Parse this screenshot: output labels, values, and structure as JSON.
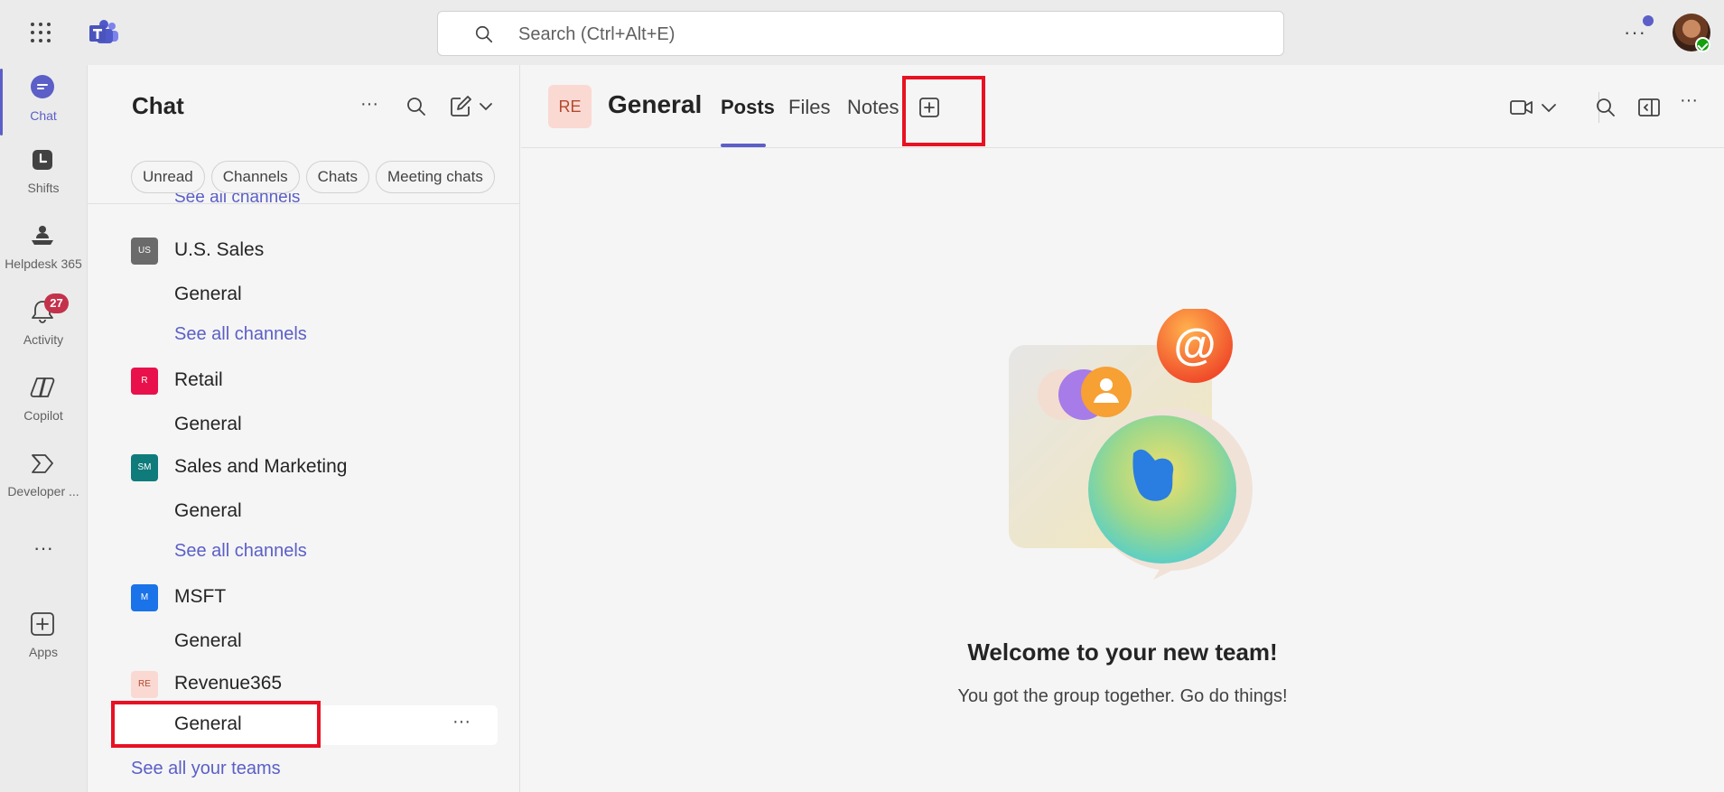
{
  "topbar": {
    "search_placeholder": "Search (Ctrl+Alt+E)",
    "more_label": "···"
  },
  "rail": {
    "items": [
      {
        "label": "Chat",
        "icon": "chat-icon",
        "active": true
      },
      {
        "label": "Shifts",
        "icon": "shifts-icon"
      },
      {
        "label": "Helpdesk 365",
        "icon": "helpdesk-icon"
      },
      {
        "label": "Activity",
        "icon": "bell-icon",
        "badge": "27"
      },
      {
        "label": "Copilot",
        "icon": "copilot-icon"
      },
      {
        "label": "Developer ...",
        "icon": "developer-icon"
      },
      {
        "label": "···",
        "icon": "more-apps-icon"
      },
      {
        "label": "Apps",
        "icon": "add-apps-icon"
      }
    ]
  },
  "list": {
    "title": "Chat",
    "more_label": "···",
    "filters": [
      "Unread",
      "Channels",
      "Chats",
      "Meeting chats"
    ],
    "scrolled_see_all": "See all channels",
    "teams": [
      {
        "initials": "US",
        "name": "U.S. Sales",
        "color": "#6b6b6b",
        "channels": [
          "General"
        ],
        "see_all": "See all channels"
      },
      {
        "initials": "R",
        "name": "Retail",
        "color": "#e8114b",
        "channels": [
          "General"
        ],
        "see_all": ""
      },
      {
        "initials": "SM",
        "name": "Sales and Marketing",
        "color": "#0f7b7b",
        "channels": [
          "General"
        ],
        "see_all": "See all channels"
      },
      {
        "initials": "M",
        "name": "MSFT",
        "color": "#1a73e8",
        "channels": [
          "General"
        ],
        "see_all": ""
      },
      {
        "initials": "RE",
        "name": "Revenue365",
        "color": "#fbd9d3",
        "channels": [
          "General"
        ],
        "see_all": ""
      }
    ],
    "selected_channel": "General",
    "selected_more": "···",
    "see_all_teams": "See all your teams"
  },
  "main": {
    "channel_initials": "RE",
    "channel_title": "General",
    "tabs": [
      {
        "label": "Posts",
        "active": true
      },
      {
        "label": "Files"
      },
      {
        "label": "Notes"
      }
    ],
    "header_more": "···",
    "welcome_title": "Welcome to your new team!",
    "welcome_subtitle": "You got the group together. Go do things!"
  },
  "colors": {
    "accent": "#5b5fc7",
    "highlight": "#e81123",
    "badge": "#c4314b"
  }
}
